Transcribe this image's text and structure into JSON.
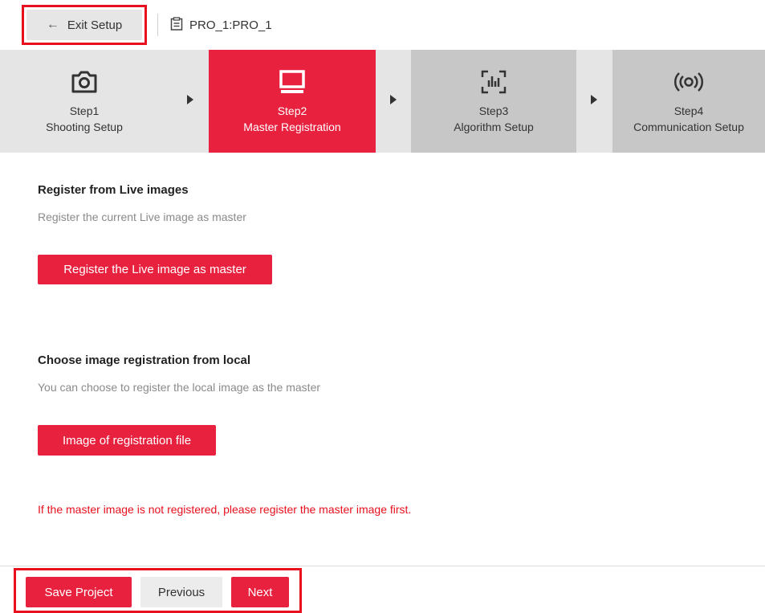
{
  "header": {
    "exit_label": "Exit Setup",
    "project_name": "PRO_1:PRO_1"
  },
  "steps": [
    {
      "num": "Step1",
      "label": "Shooting Setup",
      "icon": "camera-icon",
      "state": "done"
    },
    {
      "num": "Step2",
      "label": "Master Registration",
      "icon": "monitor-icon",
      "state": "active"
    },
    {
      "num": "Step3",
      "label": "Algorithm Setup",
      "icon": "chart-icon",
      "state": "pending"
    },
    {
      "num": "Step4",
      "label": "Communication Setup",
      "icon": "broadcast-icon",
      "state": "pending"
    }
  ],
  "live_section": {
    "title": "Register from Live images",
    "desc": "Register the current Live image as master",
    "button": "Register the Live image as master"
  },
  "local_section": {
    "title": "Choose image registration from local",
    "desc": "You can choose to register the local image as the master",
    "button": "Image of registration file"
  },
  "warning": "If the master image is not registered, please register the master image first.",
  "footer": {
    "save": "Save Project",
    "previous": "Previous",
    "next": "Next"
  },
  "colors": {
    "accent": "#e8213f",
    "highlight_border": "#e8101e",
    "warning_text": "#e8101e"
  }
}
